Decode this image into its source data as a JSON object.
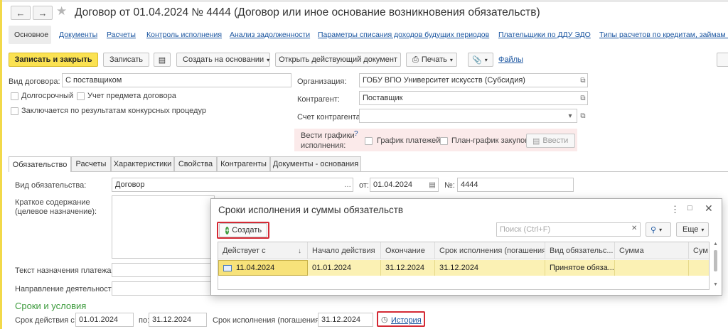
{
  "header": {
    "title": "Договор от 01.04.2024 № 4444 (Договор или иное основание возникновения обязательств)"
  },
  "nav_links": [
    "Основное",
    "Документы",
    "Расчеты",
    "Контроль исполнения",
    "Анализ задолженности",
    "Параметры списания доходов будущих периодов",
    "Плательщики по ДДУ ЭДО",
    "Типы расчетов по кредитам, займам (с"
  ],
  "toolbar": {
    "save_close": "Записать и закрыть",
    "save": "Записать",
    "create_based": "Создать на основании",
    "open_current": "Открыть действующий документ",
    "print": "Печать",
    "files": "Файлы"
  },
  "form": {
    "contract_type_label": "Вид договора:",
    "contract_type_value": "С поставщиком",
    "long_term": "Долгосрочный",
    "subject_accounting": "Учет предмета договора",
    "competitive": "Заключается по результатам конкурсных процедур",
    "org_label": "Организация:",
    "org_value": "ГОБУ ВПО Университет искусств (Субсидия)",
    "counterparty_label": "Контрагент:",
    "counterparty_value": "Поставщик",
    "account_label": "Счет контрагента:",
    "account_value": "",
    "schedules_label_1": "Вести графики",
    "schedules_label_2": "исполнения:",
    "help_mark": "?",
    "payment_schedule": "График платежей",
    "purchase_plan": "План-график закупок",
    "enter_btn": "Ввести"
  },
  "tabs": [
    "Обязательство",
    "Расчеты",
    "Характеристики",
    "Свойства",
    "Контрагенты",
    "Документы - основания"
  ],
  "obligation": {
    "type_label": "Вид обязательства:",
    "type_value": "Договор",
    "from_label": "от:",
    "date_value": "01.04.2024",
    "num_label": "№:",
    "num_value": "4444",
    "summary_label_1": "Краткое содержание",
    "summary_label_2": "(целевое назначение):",
    "payment_purpose_label": "Текст назначения платежа:",
    "direction_label": "Направление деятельности:",
    "terms_title": "Сроки и условия",
    "validity_from_label": "Срок действия с:",
    "validity_from": "01.01.2024",
    "validity_to_label": "по:",
    "validity_to": "31.12.2024",
    "deadline_label": "Срок исполнения (погашения):",
    "deadline_value": "31.12.2024",
    "history_link": "История"
  },
  "dialog": {
    "title": "Сроки исполнения и суммы обязательств",
    "create": "Создать",
    "search_placeholder": "Поиск (Ctrl+F)",
    "more": "Еще",
    "columns": [
      "Действует с",
      "Начало действия",
      "Окончание",
      "Срок исполнения (погашения)",
      "Вид обязательс...",
      "Сумма",
      "Сум"
    ],
    "rows": [
      [
        "11.04.2024",
        "01.01.2024",
        "31.12.2024",
        "31.12.2024",
        "Принятое обяза...",
        "",
        ""
      ]
    ]
  },
  "colors": {
    "accent_yellow": "#fbe252",
    "row_highlight": "#fbf1b4",
    "link": "#1a55a0",
    "green_header": "#3c9a3c",
    "red_frame": "#d42a35"
  }
}
